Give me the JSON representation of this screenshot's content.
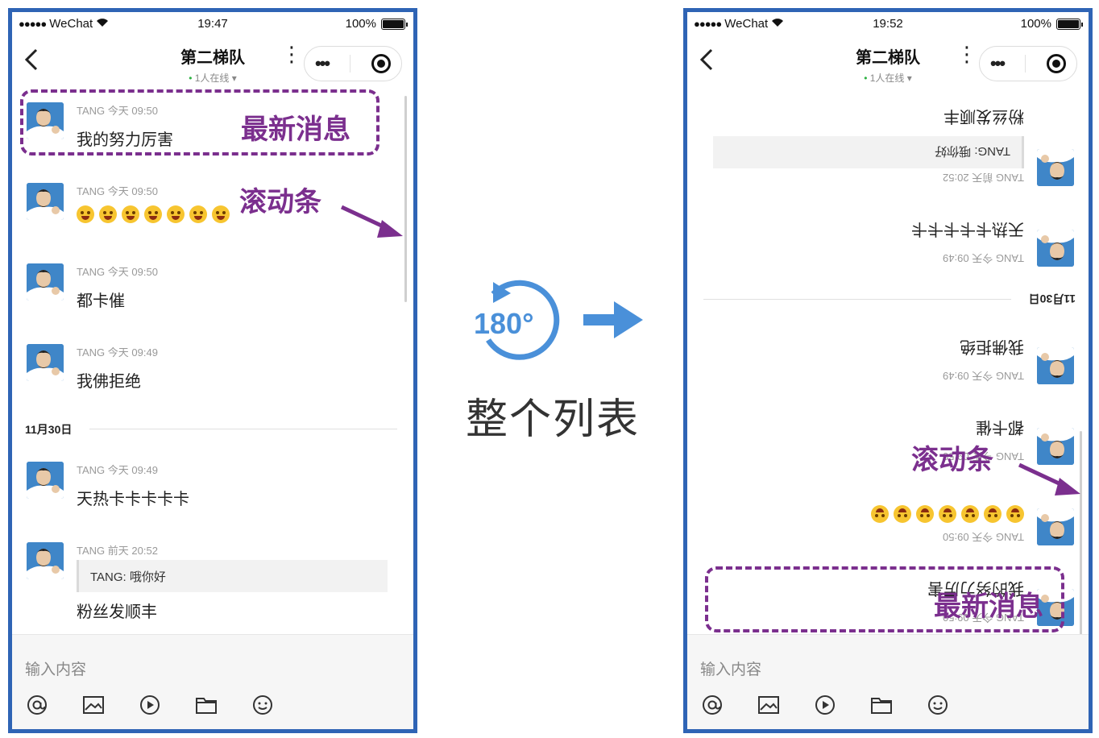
{
  "left_phone": {
    "status": {
      "signal": "●●●●●",
      "carrier": "WeChat",
      "time": "19:47",
      "battery": "100%"
    },
    "header": {
      "title": "第二梯队",
      "online": "1人在线",
      "back_icon": "chevron-left-icon",
      "more_icon": "kebab-icon"
    },
    "messages": [
      {
        "sender": "TANG",
        "time": "今天 09:50",
        "text": "我的努力厉害"
      },
      {
        "sender": "TANG",
        "time": "今天 09:50",
        "emoji_count": 7
      },
      {
        "sender": "TANG",
        "time": "今天 09:50",
        "text": "都卡催"
      },
      {
        "sender": "TANG",
        "time": "今天 09:49",
        "text": "我佛拒绝"
      },
      {
        "sender": "TANG",
        "time": "今天 09:49",
        "text": "天热卡卡卡卡卡"
      },
      {
        "sender": "TANG",
        "time": "前天 20:52",
        "quote": "TANG: 哦你好",
        "text": "粉丝发顺丰"
      }
    ],
    "date_divider": "11月30日",
    "input_placeholder": "输入内容",
    "annotations": {
      "latest": "最新消息",
      "scrollbar": "滚动条"
    }
  },
  "right_phone": {
    "status": {
      "signal": "●●●●●",
      "carrier": "WeChat",
      "time": "19:52",
      "battery": "100%"
    },
    "header": {
      "title": "第二梯队",
      "online": "1人在线"
    },
    "messages": [
      {
        "sender": "TANG",
        "time": "今天 09:50",
        "text": "我的努力厉害"
      },
      {
        "sender": "TANG",
        "time": "今天 09:50",
        "emoji_count": 7
      },
      {
        "sender": "TANG",
        "time": "今天 09:50",
        "text": "都卡催"
      },
      {
        "sender": "TANG",
        "time": "今天 09:49",
        "text": "我佛拒绝"
      },
      {
        "sender": "TANG",
        "time": "今天 09:49",
        "text": "天热卡卡卡卡卡"
      },
      {
        "sender": "TANG",
        "time": "前天 20:52",
        "quote": "TANG: 哦你好",
        "text": "粉丝发顺丰"
      }
    ],
    "date_divider": "11月30日",
    "input_placeholder": "输入内容",
    "annotations": {
      "latest": "最新消息",
      "scrollbar": "滚动条"
    }
  },
  "middle": {
    "rotate_label": "180°",
    "caption": "整个列表"
  },
  "colors": {
    "frame": "#2f64b5",
    "annotation": "#7b2f8e",
    "arrow": "#4a90d9"
  },
  "icons": [
    "at-icon",
    "image-icon",
    "video-icon",
    "folder-icon",
    "emoji-icon"
  ]
}
